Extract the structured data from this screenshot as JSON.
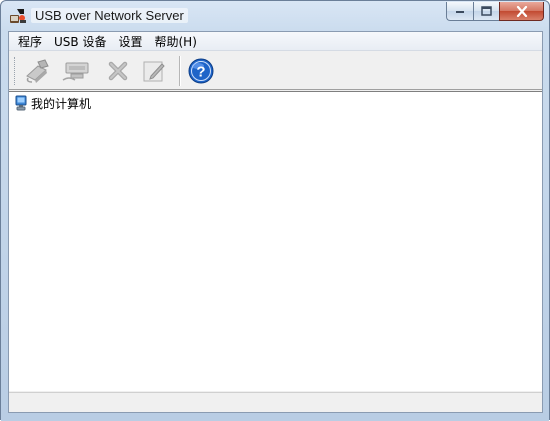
{
  "window": {
    "title": "USB over Network Server"
  },
  "menu": {
    "items": [
      "程序",
      "USB 设备",
      "设置",
      "帮助(H)"
    ]
  },
  "toolbar": {
    "buttons": [
      {
        "icon": "share-device-icon"
      },
      {
        "icon": "connect-device-icon"
      },
      {
        "icon": "delete-icon"
      },
      {
        "icon": "edit-icon"
      },
      {
        "icon": "help-icon"
      }
    ]
  },
  "tree": {
    "root_label": "我的计算机"
  },
  "colors": {
    "title_bar": "#cbdcee",
    "close_button": "#c24a31",
    "help_blue": "#1e64c8"
  }
}
